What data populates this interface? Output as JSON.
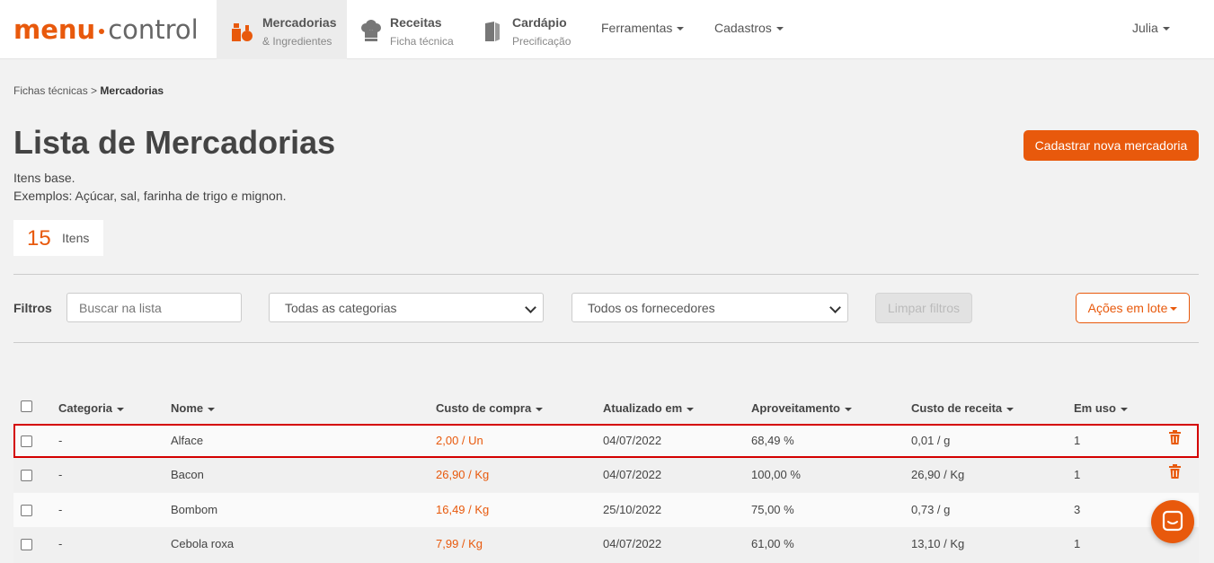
{
  "logo": {
    "part1": "menu",
    "part2": "control"
  },
  "nav": [
    {
      "title": "Mercadorias",
      "subtitle": "& Ingredientes",
      "icon": "ingredients-icon"
    },
    {
      "title": "Receitas",
      "subtitle": "Ficha técnica",
      "icon": "chef-hat-icon"
    },
    {
      "title": "Cardápio",
      "subtitle": "Precificação",
      "icon": "menu-book-icon"
    }
  ],
  "dropdowns": {
    "ferramentas": "Ferramentas",
    "cadastros": "Cadastros",
    "user": "Julia"
  },
  "breadcrumb": {
    "parent": "Fichas técnicas",
    "sep": ">",
    "current": "Mercadorias"
  },
  "page": {
    "title": "Lista de Mercadorias",
    "desc1": "Itens base.",
    "desc2": "Exemplos: Açúcar, sal, farinha de trigo e mignon.",
    "new_button": "Cadastrar nova mercadoria",
    "count": "15",
    "count_label": "Itens"
  },
  "filters": {
    "label": "Filtros",
    "search_placeholder": "Buscar na lista",
    "category": "Todas as categorias",
    "supplier": "Todos os fornecedores",
    "clear": "Limpar filtros",
    "bulk": "Ações em lote"
  },
  "table": {
    "headers": [
      "Categoria",
      "Nome",
      "Custo de compra",
      "Atualizado em",
      "Aproveitamento",
      "Custo de receita",
      "Em uso"
    ],
    "rows": [
      {
        "categoria": "-",
        "nome": "Alface",
        "custo": "2,00 / Un",
        "atualizado": "04/07/2022",
        "aproveitamento": "68,49 %",
        "receita": "0,01 / g",
        "uso": "1"
      },
      {
        "categoria": "-",
        "nome": "Bacon",
        "custo": "26,90 / Kg",
        "atualizado": "04/07/2022",
        "aproveitamento": "100,00 %",
        "receita": "26,90 / Kg",
        "uso": "1"
      },
      {
        "categoria": "-",
        "nome": "Bombom",
        "custo": "16,49 / Kg",
        "atualizado": "25/10/2022",
        "aproveitamento": "75,00 %",
        "receita": "0,73 / g",
        "uso": "3"
      },
      {
        "categoria": "-",
        "nome": "Cebola roxa",
        "custo": "7,99 / Kg",
        "atualizado": "04/07/2022",
        "aproveitamento": "61,00 %",
        "receita": "13,10 / Kg",
        "uso": "1"
      }
    ]
  },
  "colors": {
    "accent": "#e8590c",
    "highlight": "#d40000"
  }
}
